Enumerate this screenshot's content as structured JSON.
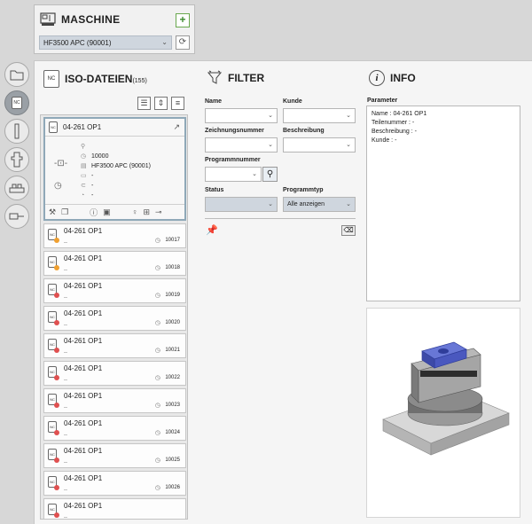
{
  "machine": {
    "title": "MASCHINE",
    "selected": "HF3500 APC (90001)",
    "add_icon": "plus-icon",
    "refresh_icon": "refresh-icon"
  },
  "tools": [
    "folder-icon",
    "nc-file-icon",
    "tool-icon",
    "holder-icon",
    "fixture-icon",
    "spindle-icon"
  ],
  "iso": {
    "title": "ISO-DATEIEN",
    "count": "(155)",
    "selected_card": {
      "name": "04-261 OP1",
      "values": [
        "10000",
        "HF3500 APC (90001)",
        "-",
        "-",
        "-"
      ]
    },
    "items": [
      {
        "name": "04-261 OP1",
        "sub": "..",
        "num": "10017",
        "color": "#f0a030"
      },
      {
        "name": "04-261 OP1",
        "sub": "..",
        "num": "10018",
        "color": "#f0a030"
      },
      {
        "name": "04-261 OP1",
        "sub": "..",
        "num": "10019",
        "color": "#e05050"
      },
      {
        "name": "04-261 OP1",
        "sub": "..",
        "num": "10020",
        "color": "#e05050"
      },
      {
        "name": "04-261 OP1",
        "sub": "..",
        "num": "10021",
        "color": "#e05050"
      },
      {
        "name": "04-261 OP1",
        "sub": "..",
        "num": "10022",
        "color": "#e05050"
      },
      {
        "name": "04-261 OP1",
        "sub": "..",
        "num": "10023",
        "color": "#e05050"
      },
      {
        "name": "04-261 OP1",
        "sub": "..",
        "num": "10024",
        "color": "#e05050"
      },
      {
        "name": "04-261 OP1",
        "sub": "..",
        "num": "10025",
        "color": "#e05050"
      },
      {
        "name": "04-261 OP1",
        "sub": "..",
        "num": "10026",
        "color": "#e05050"
      },
      {
        "name": "04-261 OP1",
        "sub": "..",
        "num": "",
        "color": "#e05050"
      }
    ]
  },
  "filter": {
    "title": "FILTER",
    "name_label": "Name",
    "kunde_label": "Kunde",
    "zeichnung_label": "Zeichnungsnummer",
    "beschreibung_label": "Beschreibung",
    "programm_label": "Programmnummer",
    "status_label": "Status",
    "programmtyp_label": "Programmtyp",
    "programmtyp_value": "Alle anzeigen"
  },
  "info": {
    "title": "INFO",
    "parameter_label": "Parameter",
    "lines": [
      "Name : 04-261 OP1",
      "Teilenummer : -",
      "Beschreibung : -",
      "Kunde : -"
    ]
  }
}
